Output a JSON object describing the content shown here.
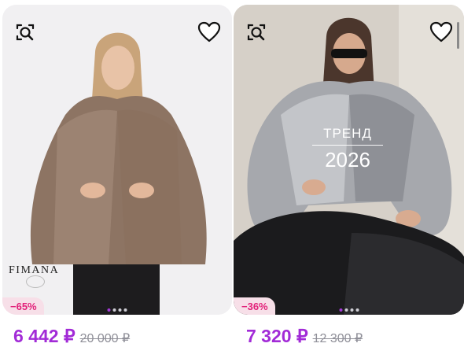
{
  "products": [
    {
      "discount": "−65%",
      "price_now": "6 442 ₽",
      "price_old": "20 000 ₽",
      "brand": "FIMANA",
      "image_icon": "fur-coat-photo",
      "dots_active": 1
    },
    {
      "discount": "−36%",
      "price_now": "7 320 ₽",
      "price_old": "12 300 ₽",
      "trend_title": "ТРЕНД",
      "trend_year": "2026",
      "image_icon": "fur-coat-photo",
      "dots_active": 1
    }
  ],
  "icons": {
    "search": "image-search-icon",
    "favorite": "heart-outline-icon"
  },
  "colors": {
    "price": "#a22bd7",
    "badge_text": "#e2227a",
    "badge_bg": "#f7dfe8"
  }
}
